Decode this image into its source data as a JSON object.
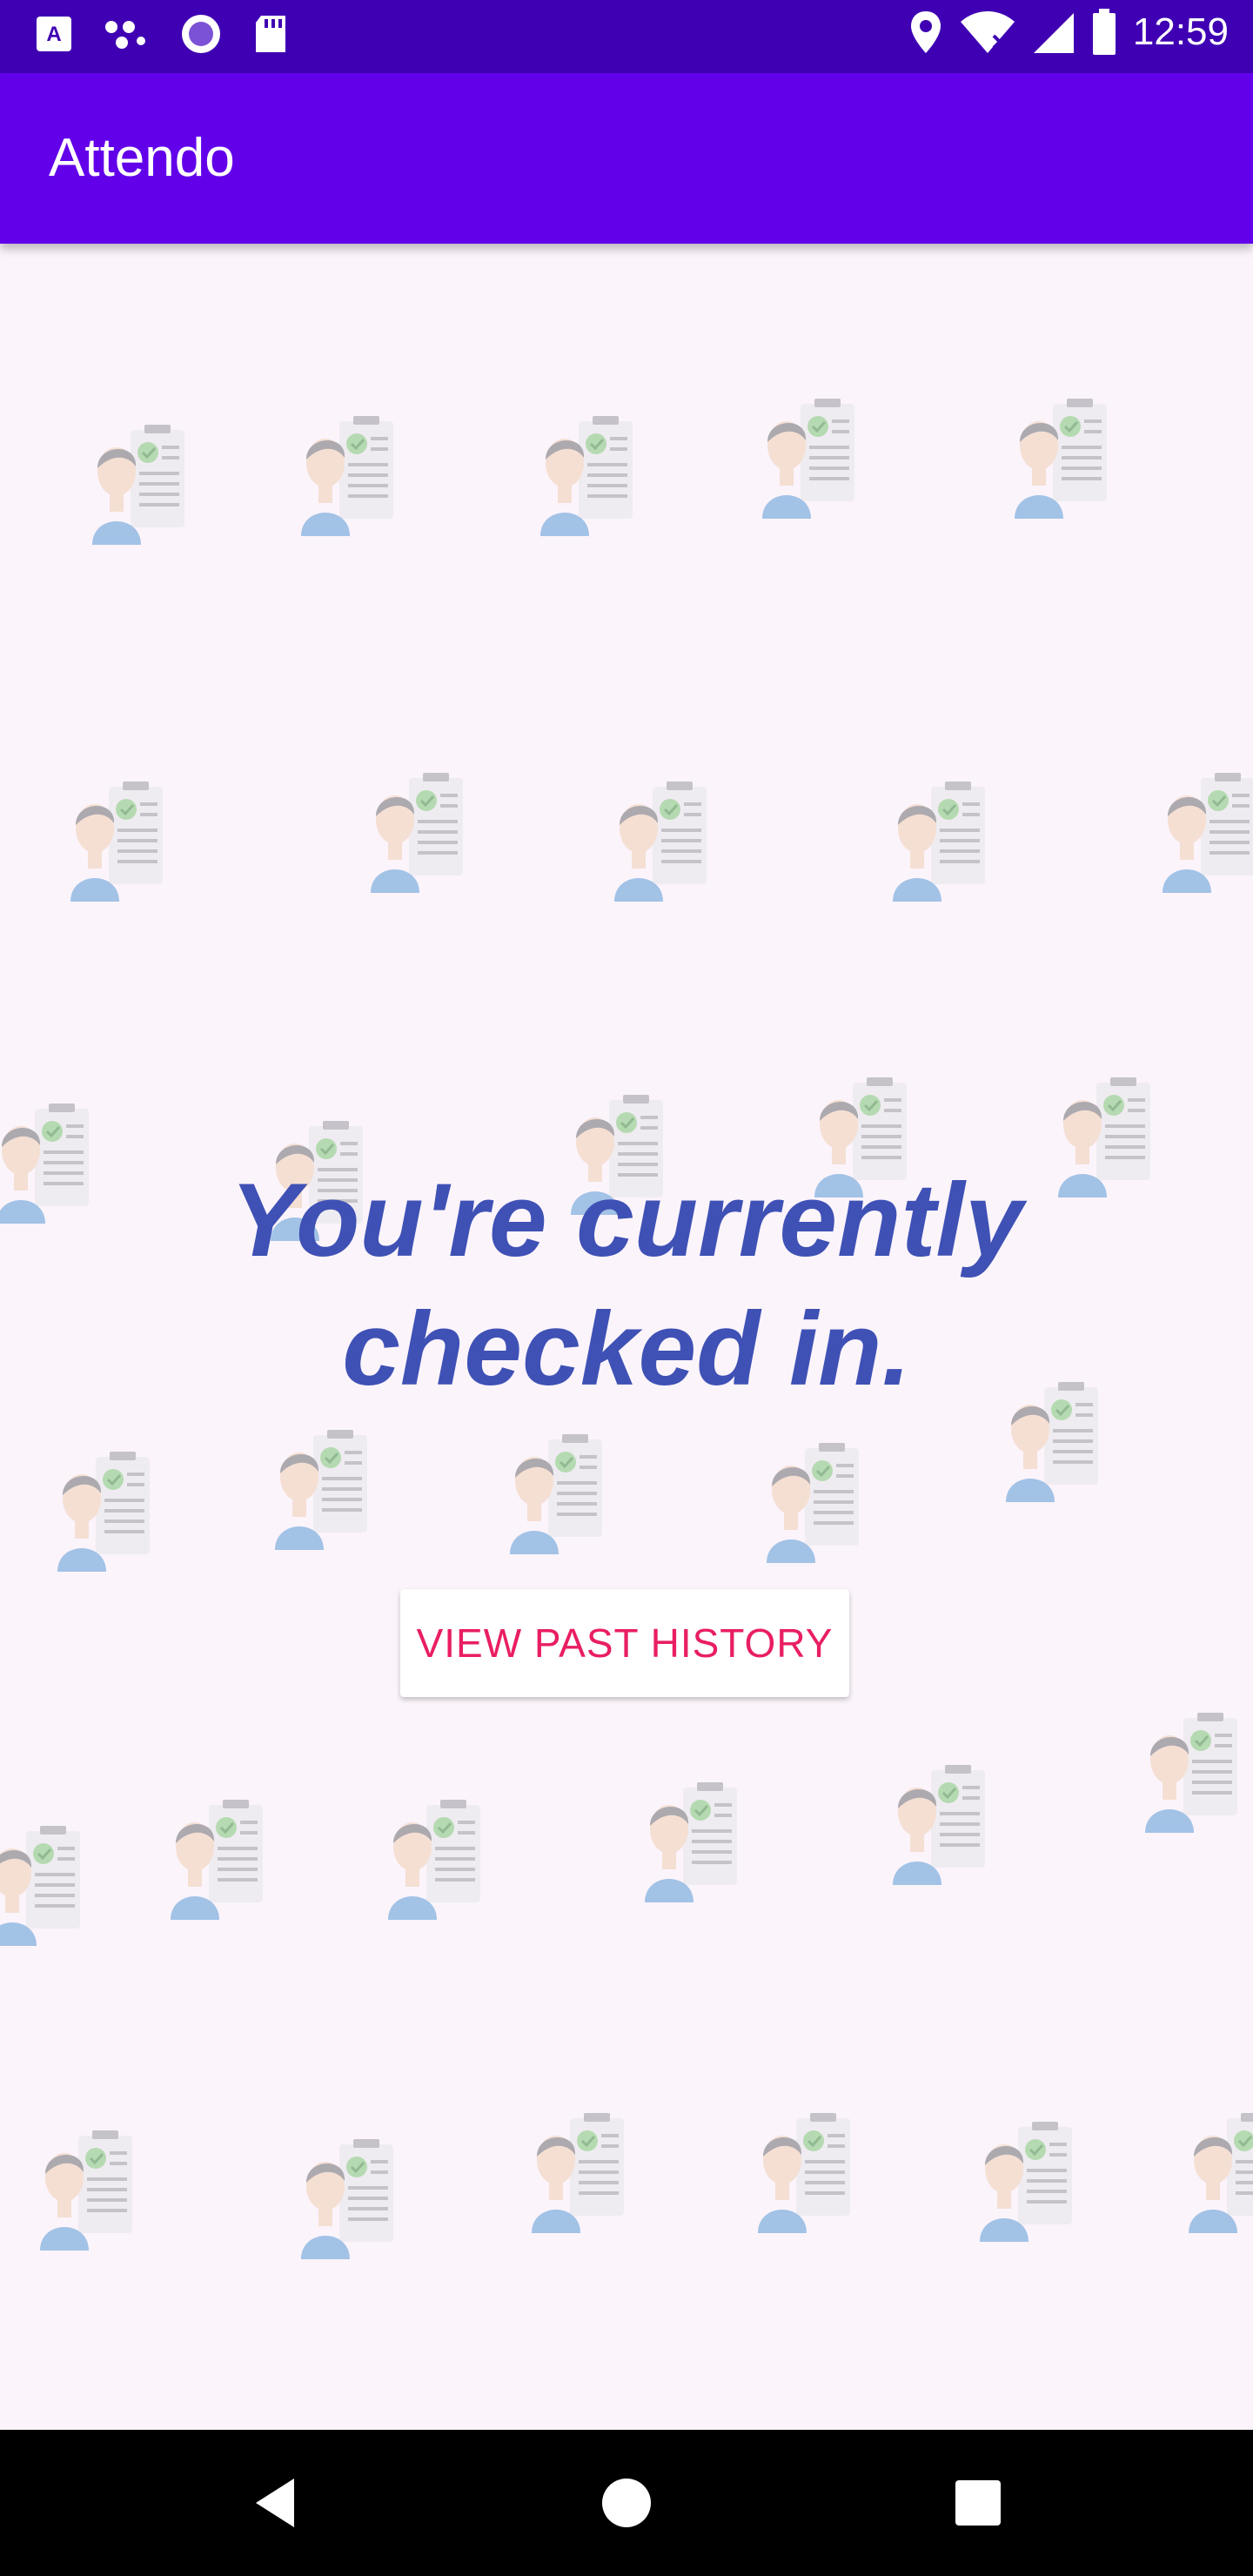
{
  "status_bar": {
    "time": "12:59",
    "icons_left": [
      "a-box-icon",
      "dots-share-icon",
      "circle-dot-icon",
      "sd-card-icon"
    ],
    "icons_right": [
      "location-icon",
      "wifi-icon",
      "signal-icon",
      "battery-icon"
    ]
  },
  "app_bar": {
    "title": "Attendo"
  },
  "main": {
    "headline_line1": "You're currently",
    "headline_line2": "checked in.",
    "history_button_label": "VIEW PAST HISTORY"
  },
  "background": {
    "tile_icon": "attendance-sheet-person-icon"
  },
  "nav_bar": {
    "buttons": [
      "back-icon",
      "home-icon",
      "recents-icon"
    ]
  },
  "colors": {
    "status_bar": "#3f00b3",
    "app_bar": "#6200ea",
    "headline": "#3f51b5",
    "button_text": "#e91e63",
    "background": "#fbf4fb"
  }
}
